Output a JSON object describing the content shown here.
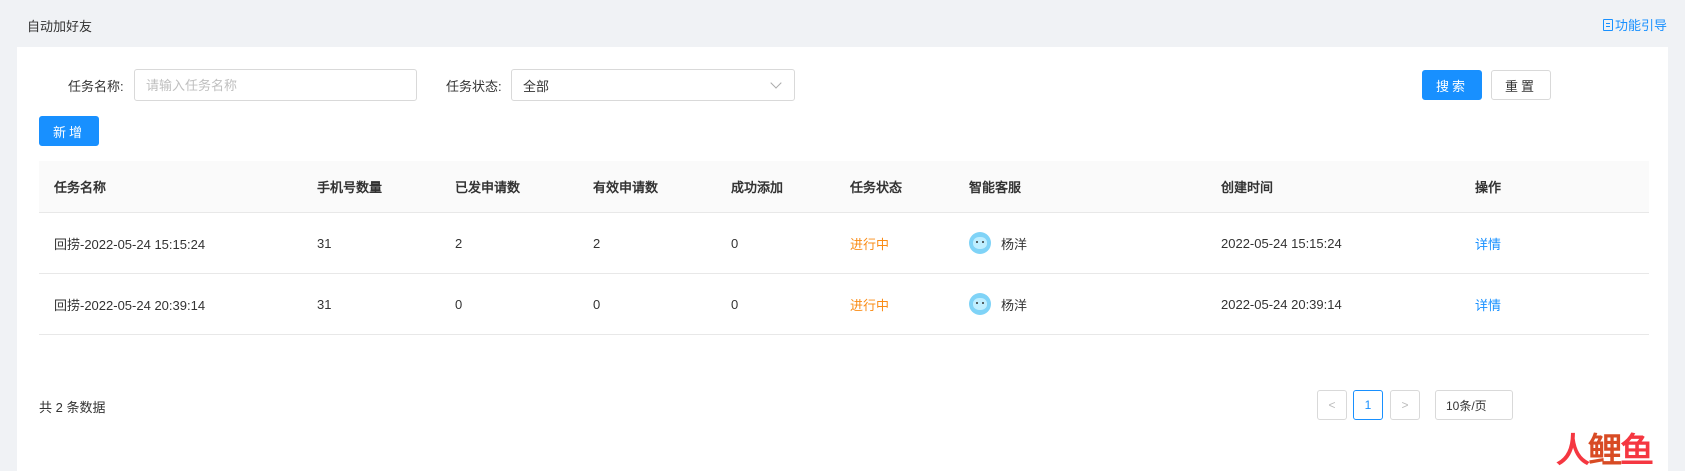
{
  "header": {
    "title": "自动加好友",
    "guide_label": "功能引导",
    "guide_icon": "document-icon"
  },
  "filters": {
    "name_label": "任务名称:",
    "name_placeholder": "请输入任务名称",
    "name_value": "",
    "status_label": "任务状态:",
    "status_value": "全部",
    "search_label": "搜索",
    "reset_label": "重置"
  },
  "actions": {
    "add_label": "新增"
  },
  "table": {
    "columns": [
      "任务名称",
      "手机号数量",
      "已发申请数",
      "有效申请数",
      "成功添加",
      "任务状态",
      "智能客服",
      "创建时间",
      "操作"
    ],
    "rows": [
      {
        "name": "回捞-2022-05-24 15:15:24",
        "phone_count": "31",
        "sent": "2",
        "valid": "2",
        "added": "0",
        "status": "进行中",
        "agent": "杨洋",
        "created": "2022-05-24 15:15:24",
        "action": "详情"
      },
      {
        "name": "回捞-2022-05-24 20:39:14",
        "phone_count": "31",
        "sent": "0",
        "valid": "0",
        "added": "0",
        "status": "进行中",
        "agent": "杨洋",
        "created": "2022-05-24 20:39:14",
        "action": "详情"
      }
    ]
  },
  "pagination": {
    "total_text": "共 2 条数据",
    "prev": "<",
    "current_page": "1",
    "next": ">",
    "page_size": "10条/页"
  },
  "watermark": {
    "text_a": "人",
    "text_b": "鲤",
    "text_c": "鱼"
  },
  "colors": {
    "primary": "#1890ff",
    "status_running": "#fa8c16"
  }
}
